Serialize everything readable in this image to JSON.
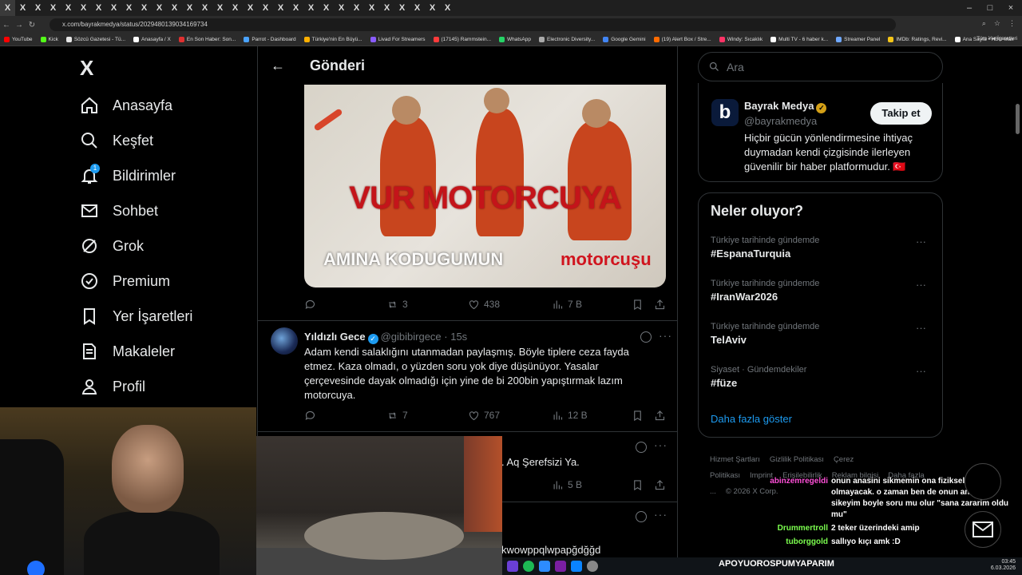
{
  "browser": {
    "url": "x.com/bayrakmedya/status/2029480139034169734",
    "tab_glyph": "X",
    "bookmarks": [
      "YouTube",
      "Kick",
      "Sözcü Gazetesi - Tü...",
      "Anasayfa / X",
      "En Son Haber: Son...",
      "Parrot - Dashboard",
      "Türkiye'nin En Büyü...",
      "Livad For Streamers",
      "(17145) Rammstein...",
      "WhatsApp",
      "Electronic Diversity...",
      "Google Gemini",
      "(19) Alert Box / Stre...",
      "Windy: Sıcaklık",
      "Multi TV - 6 haber k...",
      "Streamer Panel",
      "IMDb: Ratings, Revi...",
      "Ana Sayfa • HBO Max"
    ],
    "bookmarks_all": "Tüm Yer İşaretleri"
  },
  "nav": {
    "logo": "X",
    "items": [
      {
        "label": "Anasayfa",
        "icon": "home-icon"
      },
      {
        "label": "Keşfet",
        "icon": "search-icon"
      },
      {
        "label": "Bildirimler",
        "icon": "bell-icon",
        "badge": "1"
      },
      {
        "label": "Sohbet",
        "icon": "mail-icon"
      },
      {
        "label": "Grok",
        "icon": "grok-icon"
      },
      {
        "label": "Premium",
        "icon": "premium-icon"
      },
      {
        "label": "Yer İşaretleri",
        "icon": "bookmark-icon"
      },
      {
        "label": "Makaleler",
        "icon": "article-icon"
      },
      {
        "label": "Profil",
        "icon": "profile-icon"
      }
    ]
  },
  "post": {
    "header_title": "Gönderi",
    "meme_title": "VUR MOTORCUYA",
    "meme_sub": "AMINA KODUGUMUN",
    "meme_sub2": "motorcuşu",
    "stats": {
      "reposts": "3",
      "likes": "438",
      "views": "7 B"
    }
  },
  "reply": {
    "name": "Yıldızlı Gece",
    "handle": "@gibibirgece · 15s",
    "text": "Adam kendi salaklığını utanmadan paylaşmış. Böyle tiplere ceza fayda etmez. Kaza olmadı, o yüzden soru yok diye düşünüyor. Yasalar çerçevesinde dayak olmadığı için yine de bi 200bin yapıştırmak lazım motorcuya.",
    "stats": {
      "reposts": "7",
      "likes": "767",
      "views": "12 B"
    }
  },
  "partial": {
    "text1": ". Aq Şerefsizi Ya.",
    "views": "5 B",
    "text2": "kwowppqlwpapğdğğd"
  },
  "right": {
    "search_placeholder": "Ara",
    "profile": {
      "name": "Bayrak Medya",
      "handle": "@bayrakmedya",
      "follow": "Takip et",
      "bio": "Hiçbir gücün yönlendirmesine ihtiyaç duymadan kendi çizgisinde ilerleyen güvenilir bir haber platformudur. 🇹🇷"
    },
    "trends_title": "Neler oluyor?",
    "trends": [
      {
        "context": "Türkiye tarihinde gündemde",
        "topic": "#EspanaTurquia"
      },
      {
        "context": "Türkiye tarihinde gündemde",
        "topic": "#IranWar2026"
      },
      {
        "context": "Türkiye tarihinde gündemde",
        "topic": "TelAviv"
      },
      {
        "context": "Siyaset · Gündemdekiler",
        "topic": "#füze"
      }
    ],
    "show_more": "Daha fazla göster",
    "footer": [
      "Hizmet Şartları",
      "Gizlilik Politikası",
      "Çerez Politikası",
      "Imprint",
      "Erişilebilirlik",
      "Reklam bilgisi",
      "Daha fazla ...",
      "© 2026 X Corp."
    ]
  },
  "chat": [
    {
      "user": "abinzemregeldi",
      "color": "#ff4fd8",
      "msg": "onun anasini sikmemin ona fiziksel bir zarari olmayacak. o zaman ben de onun anasini sikeyim boyle soru mu olur \"sana zararim oldu mu\""
    },
    {
      "user": "Drummertroll",
      "color": "#7cff4f",
      "msg": "2 teker üzerindeki amip"
    },
    {
      "user": "tuborggold",
      "color": "#7cff4f",
      "msg": "sallıyo kıçı amk :D"
    }
  ],
  "taskbar": {
    "banner": "APOYUOROSPUMYAPARIM",
    "time": "03:45",
    "date": "6.03.2026"
  }
}
